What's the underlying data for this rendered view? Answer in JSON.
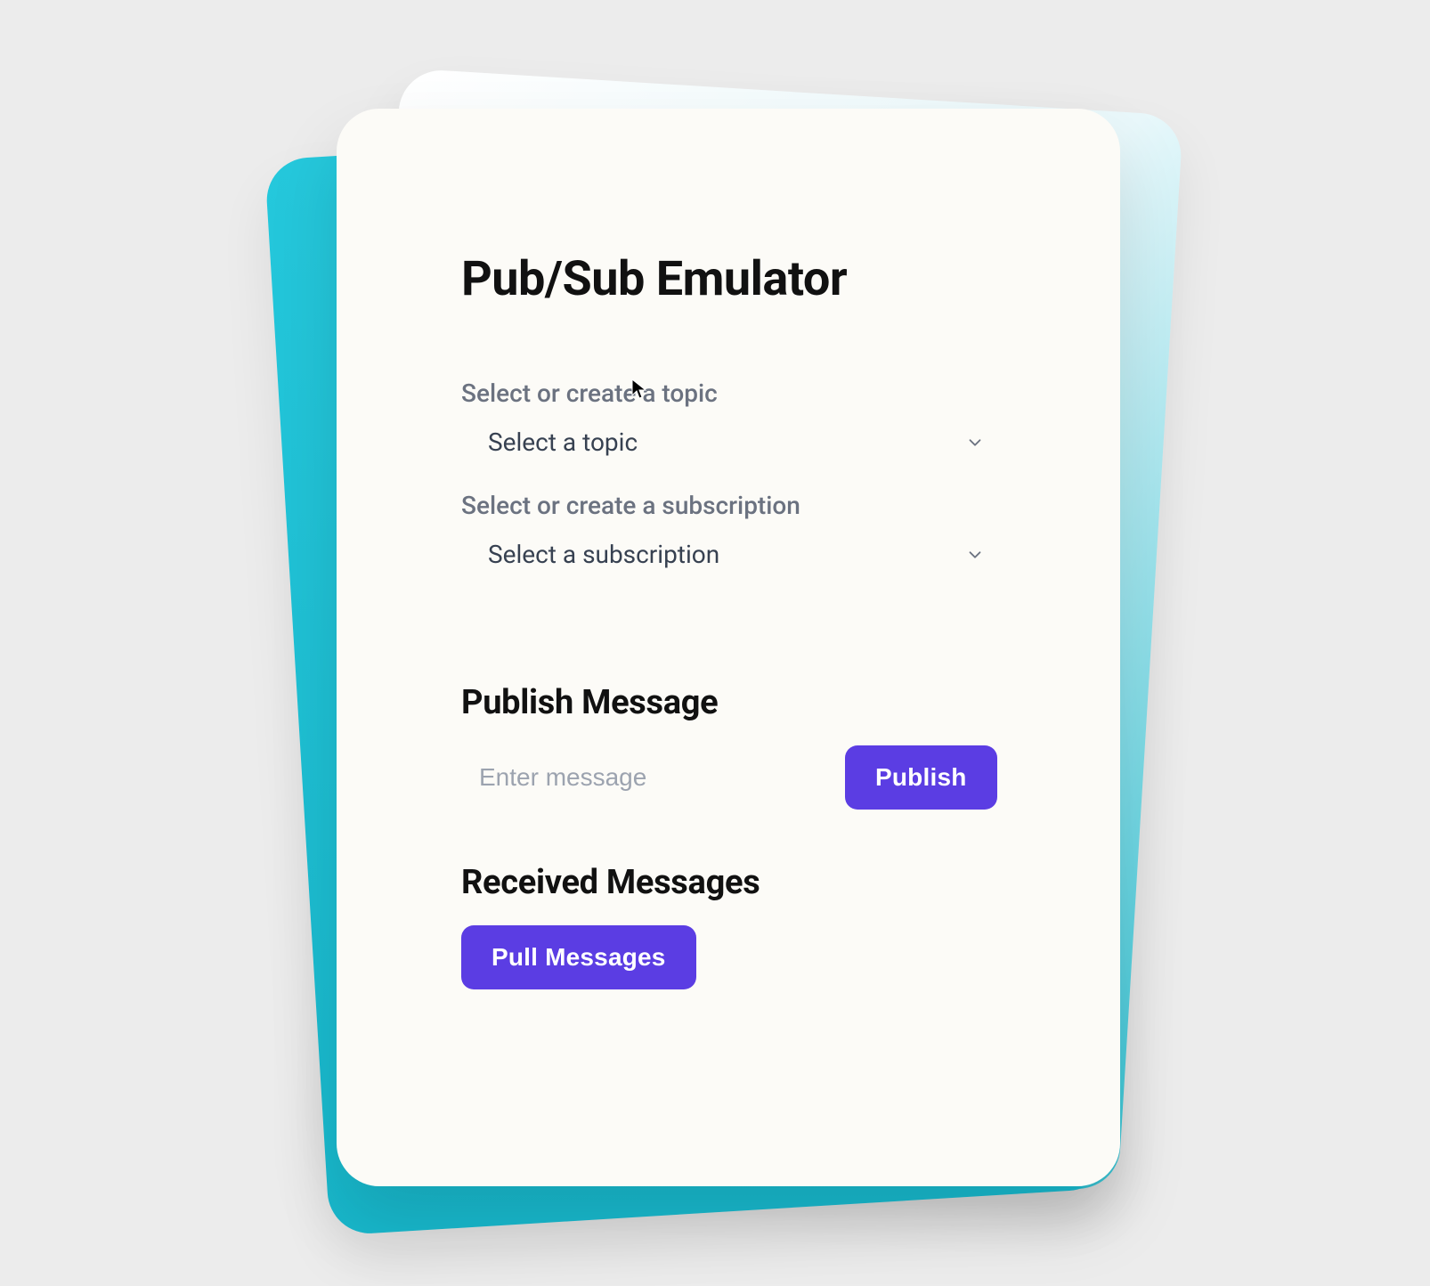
{
  "header": {
    "title": "Pub/Sub Emulator"
  },
  "topic": {
    "label": "Select or create a topic",
    "placeholder": "Select a topic"
  },
  "subscription": {
    "label": "Select or create a subscription",
    "placeholder": "Select a subscription"
  },
  "publish": {
    "heading": "Publish Message",
    "input_placeholder": "Enter message",
    "button_label": "Publish"
  },
  "received": {
    "heading": "Received Messages",
    "pull_button_label": "Pull Messages"
  },
  "colors": {
    "accent": "#5b3de3",
    "back_card_cyan": "#1fc2d6"
  }
}
